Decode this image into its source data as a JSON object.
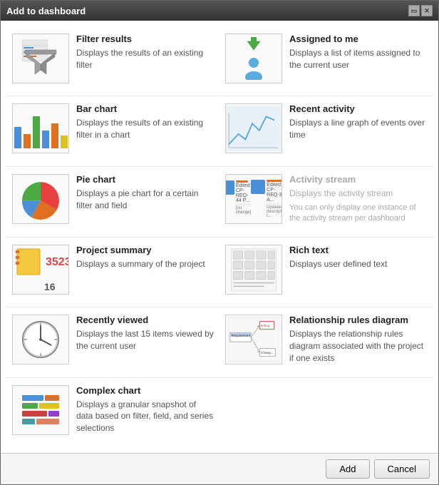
{
  "dialog": {
    "title": "Add to dashboard",
    "controls": {
      "restore": "🗗",
      "close": "✕"
    }
  },
  "items": [
    {
      "id": "filter-results",
      "title": "Filter results",
      "desc": "Displays the results of an existing filter",
      "icon": "filter-icon",
      "disabled": false,
      "col": 0
    },
    {
      "id": "assigned-to-me",
      "title": "Assigned to me",
      "desc": "Displays a list of items assigned to the current user",
      "icon": "assigned-icon",
      "disabled": false,
      "col": 1
    },
    {
      "id": "bar-chart",
      "title": "Bar chart",
      "desc": "Displays the results of an existing filter in a chart",
      "icon": "bar-chart-icon",
      "disabled": false,
      "col": 0
    },
    {
      "id": "recent-activity",
      "title": "Recent activity",
      "desc": "Displays a line graph of events over time",
      "icon": "recent-activity-icon",
      "disabled": false,
      "col": 1
    },
    {
      "id": "pie-chart",
      "title": "Pie chart",
      "desc": "Displays a pie chart for a certain filter and field",
      "icon": "pie-icon",
      "disabled": false,
      "col": 0
    },
    {
      "id": "activity-stream",
      "title": "Activity stream",
      "desc": "Displays the activity stream",
      "extra": "You can only display one instance of the activity stream per dashboard",
      "icon": "activity-stream-icon",
      "disabled": true,
      "col": 1
    },
    {
      "id": "project-summary",
      "title": "Project summary",
      "desc": "Displays a summary of the project",
      "icon": "project-summary-icon",
      "disabled": false,
      "col": 0
    },
    {
      "id": "rich-text",
      "title": "Rich text",
      "desc": "Displays user defined text",
      "icon": "rich-text-icon",
      "disabled": false,
      "col": 1
    },
    {
      "id": "recently-viewed",
      "title": "Recently viewed",
      "desc": "Displays the last 15 items viewed by the current user",
      "icon": "clock-icon",
      "disabled": false,
      "col": 0
    },
    {
      "id": "relationship-rules",
      "title": "Relationship rules diagram",
      "desc": "Displays the relationship rules diagram associated with the project if one exists",
      "icon": "rel-rules-icon",
      "disabled": false,
      "col": 1
    },
    {
      "id": "complex-chart",
      "title": "Complex chart",
      "desc": "Displays a granular snapshot of data based on filter, field, and series selections",
      "icon": "complex-chart-icon",
      "disabled": false,
      "col": 0
    }
  ],
  "footer": {
    "add_label": "Add",
    "cancel_label": "Cancel"
  }
}
